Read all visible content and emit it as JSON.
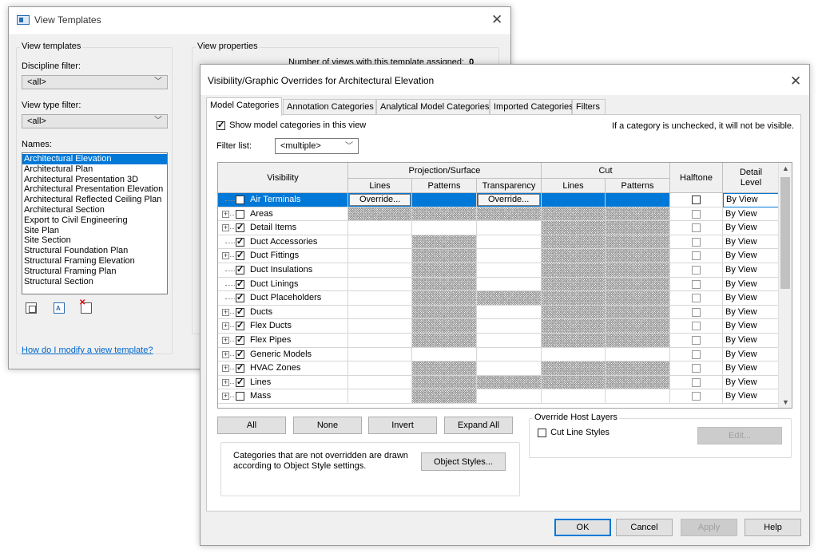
{
  "bg_window": {
    "title": "View Templates",
    "view_templates_caption": "View templates",
    "discipline_filter_label": "Discipline filter:",
    "discipline_filter_value": "<all>",
    "view_type_filter_label": "View type filter:",
    "view_type_filter_value": "<all>",
    "names_label": "Names:",
    "names": [
      "Architectural Elevation",
      "Architectural Plan",
      "Architectural Presentation 3D",
      "Architectural Presentation Elevation",
      "Architectural Reflected Ceiling Plan",
      "Architectural Section",
      "Export to Civil Engineering",
      "Site Plan",
      "Site Section",
      "Structural Foundation Plan",
      "Structural Framing Elevation",
      "Structural Framing Plan",
      "Structural Section"
    ],
    "help_link": "How do I modify a view template?",
    "view_properties_caption": "View properties",
    "views_assigned_label": "Number of views with this template assigned:",
    "views_assigned_value": "0"
  },
  "dialog": {
    "title": "Visibility/Graphic Overrides for Architectural Elevation",
    "tabs": [
      "Model Categories",
      "Annotation Categories",
      "Analytical Model Categories",
      "Imported Categories",
      "Filters"
    ],
    "show_categories_label": "Show model categories in this view",
    "unchecked_hint": "If a category is unchecked, it will not be visible.",
    "filter_list_label": "Filter list:",
    "filter_list_value": "<multiple>",
    "columns": {
      "visibility": "Visibility",
      "projection_surface": "Projection/Surface",
      "cut": "Cut",
      "lines": "Lines",
      "patterns": "Patterns",
      "transparency": "Transparency",
      "cut_lines": "Lines",
      "cut_patterns": "Patterns",
      "halftone": "Halftone",
      "detail_level": "Detail Level"
    },
    "override_label": "Override...",
    "rows": [
      {
        "name": "Air Terminals",
        "expand": false,
        "checked": true,
        "selected": true,
        "detail": "By View",
        "hatch": [
          false,
          false,
          false,
          false,
          false
        ]
      },
      {
        "name": "Areas",
        "expand": true,
        "checked": false,
        "selected": false,
        "detail": "By View",
        "hatch": [
          true,
          true,
          true,
          true,
          true
        ]
      },
      {
        "name": "Detail Items",
        "expand": true,
        "checked": true,
        "selected": false,
        "detail": "By View",
        "hatch": [
          false,
          false,
          false,
          true,
          true
        ]
      },
      {
        "name": "Duct Accessories",
        "expand": false,
        "checked": true,
        "selected": false,
        "detail": "By View",
        "hatch": [
          false,
          true,
          false,
          true,
          true
        ]
      },
      {
        "name": "Duct Fittings",
        "expand": true,
        "checked": true,
        "selected": false,
        "detail": "By View",
        "hatch": [
          false,
          true,
          false,
          true,
          true
        ]
      },
      {
        "name": "Duct Insulations",
        "expand": false,
        "checked": true,
        "selected": false,
        "detail": "By View",
        "hatch": [
          false,
          true,
          false,
          true,
          true
        ]
      },
      {
        "name": "Duct Linings",
        "expand": false,
        "checked": true,
        "selected": false,
        "detail": "By View",
        "hatch": [
          false,
          true,
          false,
          true,
          true
        ]
      },
      {
        "name": "Duct Placeholders",
        "expand": false,
        "checked": true,
        "selected": false,
        "detail": "By View",
        "hatch": [
          false,
          true,
          true,
          true,
          true
        ]
      },
      {
        "name": "Ducts",
        "expand": true,
        "checked": true,
        "selected": false,
        "detail": "By View",
        "hatch": [
          false,
          true,
          false,
          true,
          true
        ]
      },
      {
        "name": "Flex Ducts",
        "expand": true,
        "checked": true,
        "selected": false,
        "detail": "By View",
        "hatch": [
          false,
          true,
          false,
          true,
          true
        ]
      },
      {
        "name": "Flex Pipes",
        "expand": true,
        "checked": true,
        "selected": false,
        "detail": "By View",
        "hatch": [
          false,
          true,
          false,
          true,
          true
        ]
      },
      {
        "name": "Generic Models",
        "expand": true,
        "checked": true,
        "selected": false,
        "detail": "By View",
        "hatch": [
          false,
          false,
          false,
          false,
          false
        ]
      },
      {
        "name": "HVAC Zones",
        "expand": true,
        "checked": true,
        "selected": false,
        "detail": "By View",
        "hatch": [
          false,
          true,
          false,
          true,
          true
        ]
      },
      {
        "name": "Lines",
        "expand": true,
        "checked": true,
        "selected": false,
        "detail": "By View",
        "hatch": [
          false,
          true,
          true,
          true,
          true
        ]
      },
      {
        "name": "Mass",
        "expand": true,
        "checked": false,
        "selected": false,
        "detail": "By View",
        "hatch": [
          false,
          true,
          false,
          false,
          false
        ]
      }
    ],
    "buttons": {
      "all": "All",
      "none": "None",
      "invert": "Invert",
      "expand_all": "Expand All",
      "object_styles": "Object Styles...",
      "edit": "Edit...",
      "ok": "OK",
      "cancel": "Cancel",
      "apply": "Apply",
      "help": "Help"
    },
    "override_host_layers": "Override Host Layers",
    "cut_line_styles": "Cut Line Styles",
    "object_styles_note": "Categories that are not overridden are drawn according to Object Style settings."
  },
  "colors": {
    "selection": "#0078d7",
    "link": "#0066cc"
  }
}
